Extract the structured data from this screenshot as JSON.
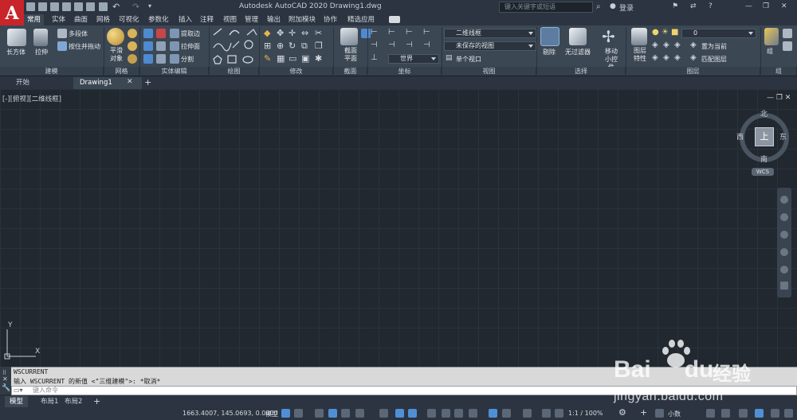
{
  "app": {
    "logo": "A",
    "title": "Autodesk AutoCAD 2020    Drawing1.dwg"
  },
  "search": {
    "placeholder": "键入关键字或短语"
  },
  "user": {
    "login": "登录"
  },
  "ribbon_tabs": [
    "常用",
    "实体",
    "曲面",
    "网格",
    "可视化",
    "参数化",
    "插入",
    "注释",
    "视图",
    "管理",
    "输出",
    "附加模块",
    "协作",
    "精选应用"
  ],
  "ribbon_active_tab": "常用",
  "panels": {
    "modeling": {
      "title": "建模",
      "box": "长方体",
      "extrude": "拉伸",
      "polysolid": "多段体",
      "presspull": "按住并拖动"
    },
    "mesh": {
      "title": "网格",
      "smooth": "平滑对象"
    },
    "solid_edit": {
      "title": "实体编辑",
      "extract_edges": "提取边",
      "extrude_faces": "拉伸面",
      "separate": "分割"
    },
    "draw": {
      "title": "绘图"
    },
    "modify": {
      "title": "修改"
    },
    "section": {
      "title": "截面",
      "plane": "截面平面"
    },
    "coords": {
      "title": "坐标",
      "world": "世界"
    },
    "view": {
      "title": "视图",
      "visual_style": "二维线框",
      "saved_view": "未保存的视图",
      "viewport": "单个视口"
    },
    "selection": {
      "title": "选择",
      "cull": "剔除",
      "no_filter": "无过滤器",
      "gizmo": "移动小控件"
    },
    "layers": {
      "title": "图层",
      "layer_props": "图层特性",
      "layer_value": "0",
      "set_current": "置为当前",
      "match_layer": "匹配图层"
    },
    "groups": {
      "title": "组",
      "group": "组"
    }
  },
  "file_tabs": [
    "开始",
    "Drawing1"
  ],
  "viewport_label": "[-][俯视][二维线框]",
  "viewcube": {
    "top": "上",
    "north": "北",
    "south": "南",
    "east": "东",
    "west": "西",
    "wcs": "WCS"
  },
  "ucs": {
    "x": "X",
    "y": "Y"
  },
  "command": {
    "history": [
      "WSCURRENT",
      "输入 WSCURRENT 的新值 <\"三维建模\">: *取消*"
    ],
    "placeholder": "键入命令"
  },
  "layout_tabs": [
    "模型",
    "布局1",
    "布局2"
  ],
  "status": {
    "coords": "1663.4007, 145.0693, 0.0000",
    "model": "模型",
    "scale": "1:1 / 100%",
    "units": "小数"
  },
  "watermark": {
    "brand": "Bai",
    "brand2": "du",
    "cn": "经验",
    "url": "jingyan.baidu.com"
  },
  "colors": {
    "accent": "#3a8ee6",
    "logo_red": "#c8252b",
    "ribbon": "#3c4754"
  }
}
